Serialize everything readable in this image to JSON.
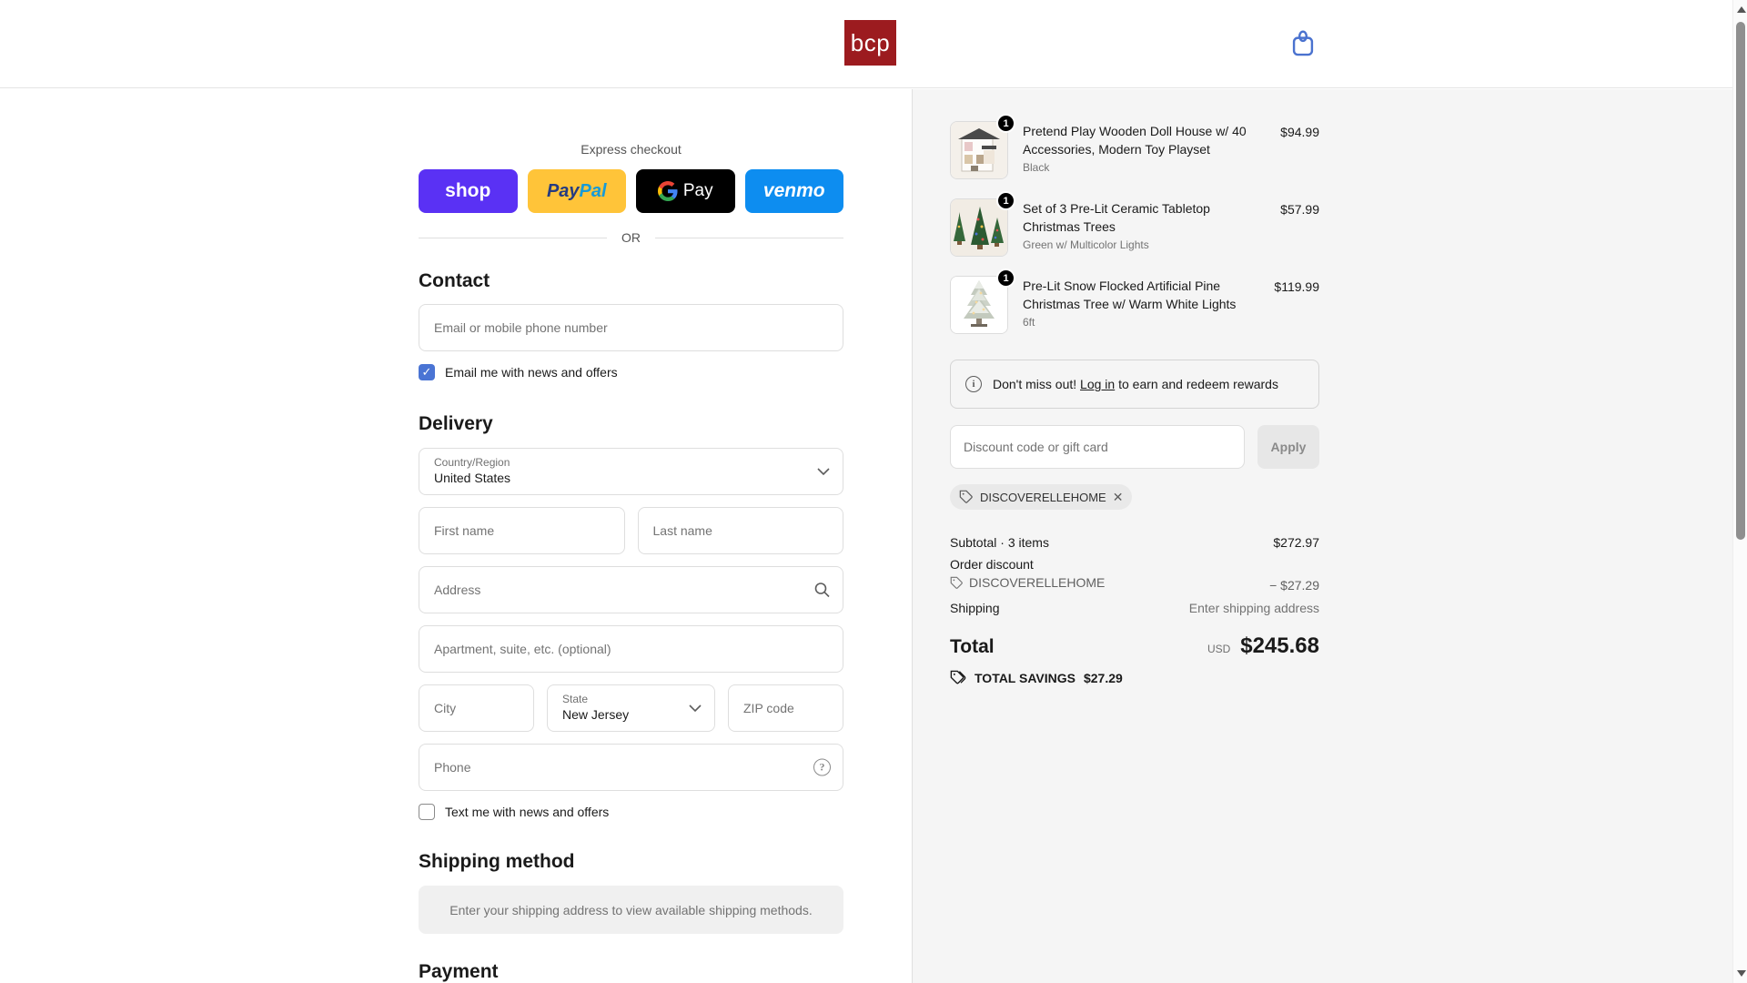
{
  "header": {
    "logo_text": "bcp"
  },
  "express": {
    "title": "Express checkout",
    "or_label": "OR",
    "shop_label": "shop",
    "paypal_pay": "Pay",
    "paypal_pal": "Pal",
    "gpay_label": "Pay",
    "venmo_label": "venmo"
  },
  "contact": {
    "heading": "Contact",
    "email_placeholder": "Email or mobile phone number",
    "newsletter_label": "Email me with news and offers",
    "newsletter_checked": true
  },
  "delivery": {
    "heading": "Delivery",
    "country_label": "Country/Region",
    "country_value": "United States",
    "first_name_placeholder": "First name",
    "last_name_placeholder": "Last name",
    "address_placeholder": "Address",
    "apartment_placeholder": "Apartment, suite, etc. (optional)",
    "city_placeholder": "City",
    "state_label": "State",
    "state_value": "New Jersey",
    "zip_placeholder": "ZIP code",
    "phone_placeholder": "Phone",
    "sms_label": "Text me with news and offers",
    "sms_checked": false
  },
  "shipping_method": {
    "heading": "Shipping method",
    "empty_message": "Enter your shipping address to view available shipping methods."
  },
  "payment": {
    "heading": "Payment"
  },
  "order_summary": {
    "items": [
      {
        "qty": "1",
        "title": "Pretend Play Wooden Doll House w/ 40 Accessories, Modern Toy Playset",
        "variant": "Black",
        "price": "$94.99"
      },
      {
        "qty": "1",
        "title": "Set of 3 Pre-Lit Ceramic Tabletop Christmas Trees",
        "variant": "Green w/ Multicolor Lights",
        "price": "$57.99"
      },
      {
        "qty": "1",
        "title": "Pre-Lit Snow Flocked Artificial Pine Christmas Tree w/ Warm White Lights",
        "variant": "6ft",
        "price": "$119.99"
      }
    ],
    "rewards": {
      "text_before": "Don't miss out!",
      "link_label": "Log in",
      "text_after": "to earn and redeem rewards"
    },
    "discount": {
      "placeholder": "Discount code or gift card",
      "apply_label": "Apply",
      "applied_code": "DISCOVERELLEHOME"
    },
    "totals": {
      "subtotal_label": "Subtotal · 3 items",
      "subtotal_value": "$272.97",
      "discount_section_label": "Order discount",
      "discount_code": "DISCOVERELLEHOME",
      "discount_value": "− $27.29",
      "shipping_label": "Shipping",
      "shipping_value": "Enter shipping address",
      "total_label": "Total",
      "currency": "USD",
      "total_value": "$245.68",
      "savings_label": "TOTAL SAVINGS",
      "savings_value": "$27.29"
    }
  },
  "icons": {
    "check_glyph": "✓",
    "close_glyph": "✕",
    "info_glyph": "i",
    "question_glyph": "?"
  },
  "colors": {
    "brand_red": "#9C1B1F",
    "shop_purple": "#5A31F4",
    "paypal_yellow": "#FFC439",
    "gpay_black": "#000000",
    "venmo_blue": "#0D8DF0",
    "accent_blue": "#4A74D4",
    "panel_gray": "#F5F5F5"
  }
}
